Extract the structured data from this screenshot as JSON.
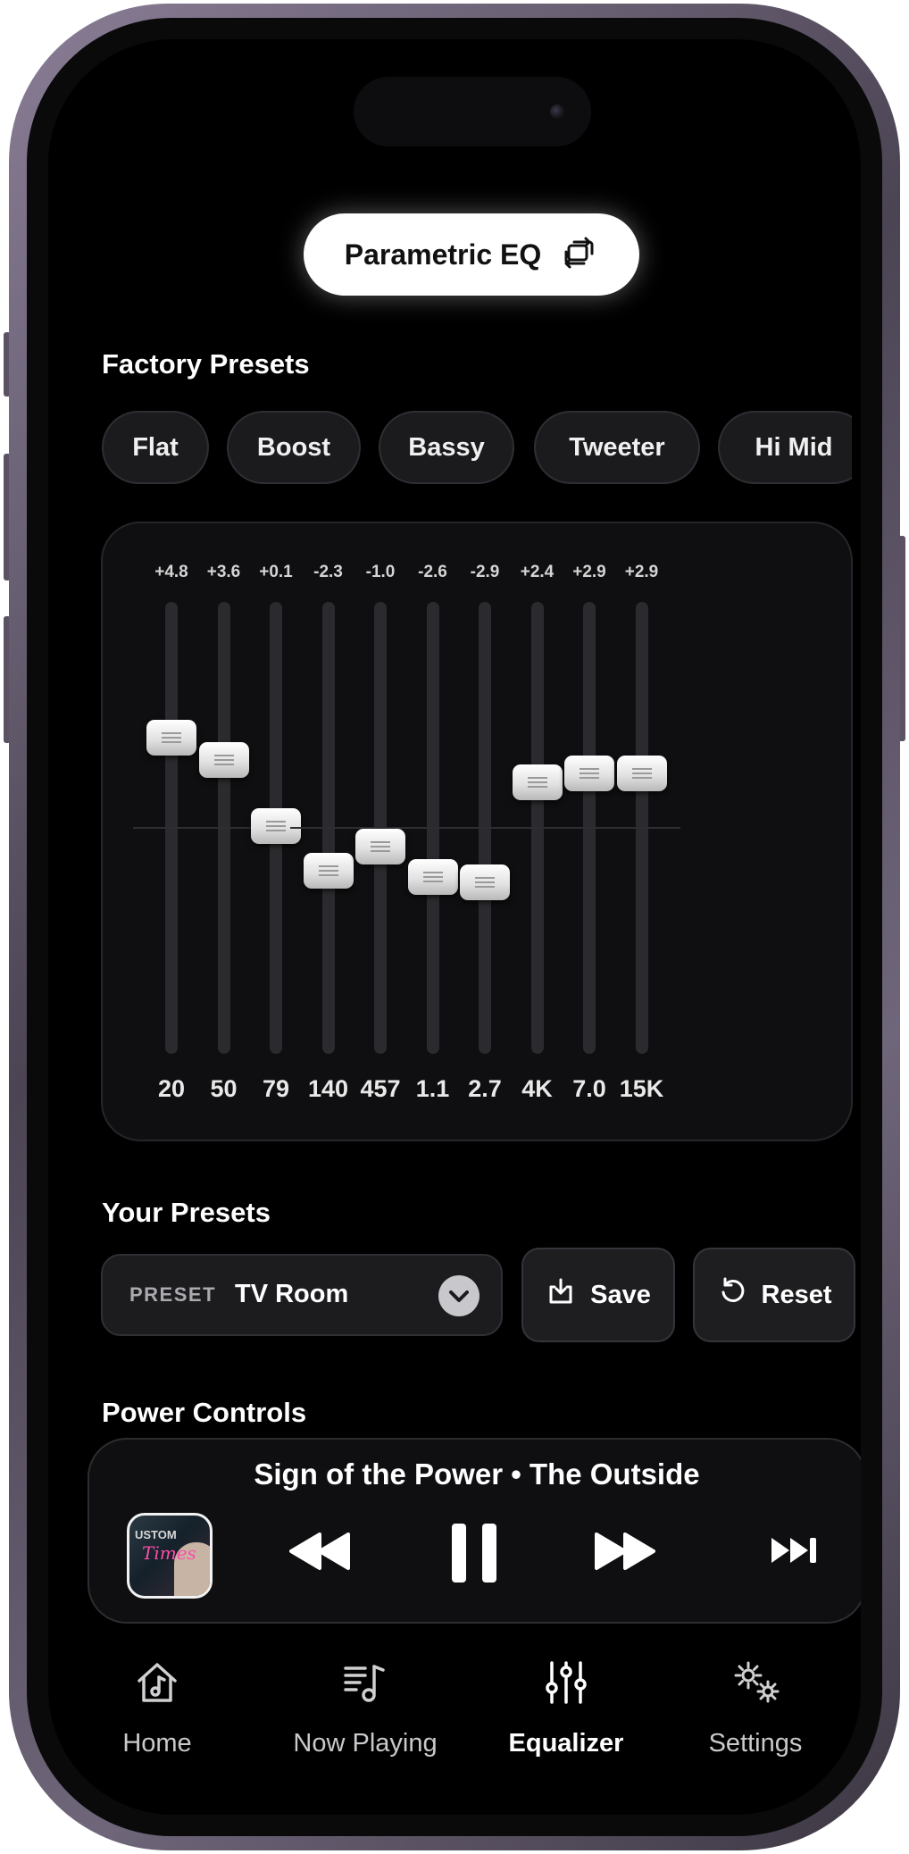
{
  "header": {
    "mode_label": "Parametric EQ"
  },
  "factory_presets": {
    "title": "Factory Presets",
    "items": [
      "Flat",
      "Boost",
      "Bassy",
      "Tweeter",
      "Hi Mid"
    ]
  },
  "equalizer": {
    "gain_range_db": [
      -12,
      12
    ],
    "bands": [
      {
        "freq": "20",
        "value": "+4.8"
      },
      {
        "freq": "50",
        "value": "+3.6"
      },
      {
        "freq": "79",
        "value": "+0.1"
      },
      {
        "freq": "140",
        "value": "-2.3"
      },
      {
        "freq": "457",
        "value": "-1.0"
      },
      {
        "freq": "1.1",
        "value": "-2.6"
      },
      {
        "freq": "2.7",
        "value": "-2.9"
      },
      {
        "freq": "4K",
        "value": "+2.4"
      },
      {
        "freq": "7.0",
        "value": "+2.9"
      },
      {
        "freq": "15K",
        "value": "+2.9"
      }
    ]
  },
  "your_presets": {
    "title": "Your Presets",
    "select_tag": "PRESET",
    "selected": "TV Room",
    "save_label": "Save",
    "reset_label": "Reset"
  },
  "power_controls": {
    "title": "Power Controls",
    "now_playing": "Sign of the Power • The Outside",
    "album_text_top": "USTOM",
    "album_script": "Times"
  },
  "tabbar": {
    "items": [
      {
        "label": "Home",
        "icon": "home-music-icon"
      },
      {
        "label": "Now Playing",
        "icon": "music-list-icon"
      },
      {
        "label": "Equalizer",
        "icon": "sliders-icon",
        "active": true
      },
      {
        "label": "Settings",
        "icon": "gears-icon"
      }
    ]
  }
}
